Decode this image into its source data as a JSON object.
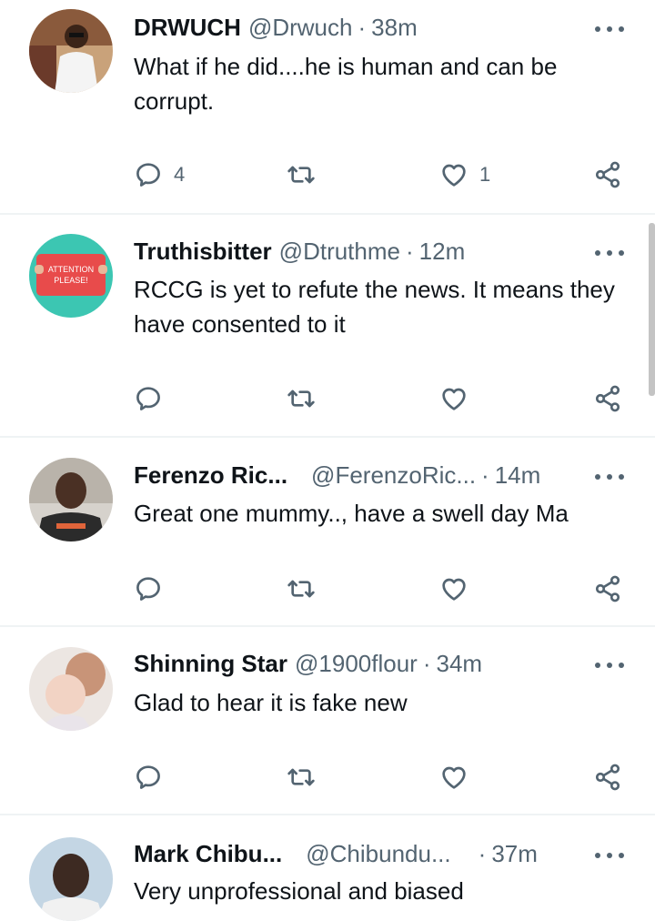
{
  "replies": [
    {
      "name": "DRWUCH",
      "handle": "@Drwuch",
      "time": "38m",
      "text": "What if he did....he is human and can be corrupt.",
      "reply_count": "4",
      "retweet_count": "",
      "like_count": "1"
    },
    {
      "name": "Truthisbitter",
      "handle": "@Dtruthme",
      "time": "12m",
      "text": "RCCG is yet to refute the news. It means they have consented to it",
      "reply_count": "",
      "retweet_count": "",
      "like_count": "",
      "avatar_text_1": "ATTENTION",
      "avatar_text_2": "PLEASE!"
    },
    {
      "name": "Ferenzo Ric...",
      "handle": "@FerenzoRic...",
      "time": "14m",
      "text": "Great one mummy.., have a swell day Ma",
      "reply_count": "",
      "retweet_count": "",
      "like_count": ""
    },
    {
      "name": "Shinning Star",
      "handle": "@1900flour",
      "time": "34m",
      "text": "Glad  to hear it is fake new",
      "reply_count": "",
      "retweet_count": "",
      "like_count": ""
    },
    {
      "name": "Mark Chibu...",
      "handle": "@Chibundu...",
      "time": "37m",
      "text": "Very unprofessional and biased"
    }
  ],
  "separator": "·",
  "icons": {
    "reply": "reply-icon",
    "retweet": "retweet-icon",
    "like": "heart-icon",
    "share": "share-icon",
    "more": "more-icon"
  },
  "colors": {
    "text": "#0f1419",
    "secondary": "#536471",
    "divider": "#eff3f4"
  }
}
